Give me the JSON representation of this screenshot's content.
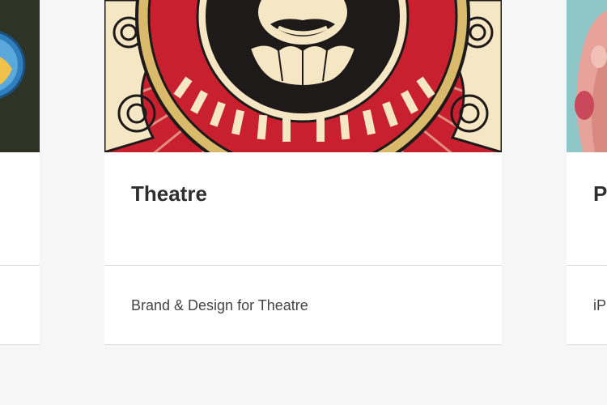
{
  "cards": [
    {
      "title": "",
      "subtitle": ""
    },
    {
      "title": "Theatre",
      "subtitle": "Brand & Design for Theatre"
    },
    {
      "title": "P",
      "subtitle": "iP"
    }
  ],
  "colors": {
    "background": "#f6f6f6",
    "card": "#ffffff",
    "poster_red": "#c8202e",
    "poster_cream": "#f5e6c4",
    "poster_dark": "#1e1a1a",
    "poster_gold": "#d9b96a"
  },
  "icons": [
    "globe-icon",
    "theatre-poster-emblem",
    "hand-photo"
  ]
}
